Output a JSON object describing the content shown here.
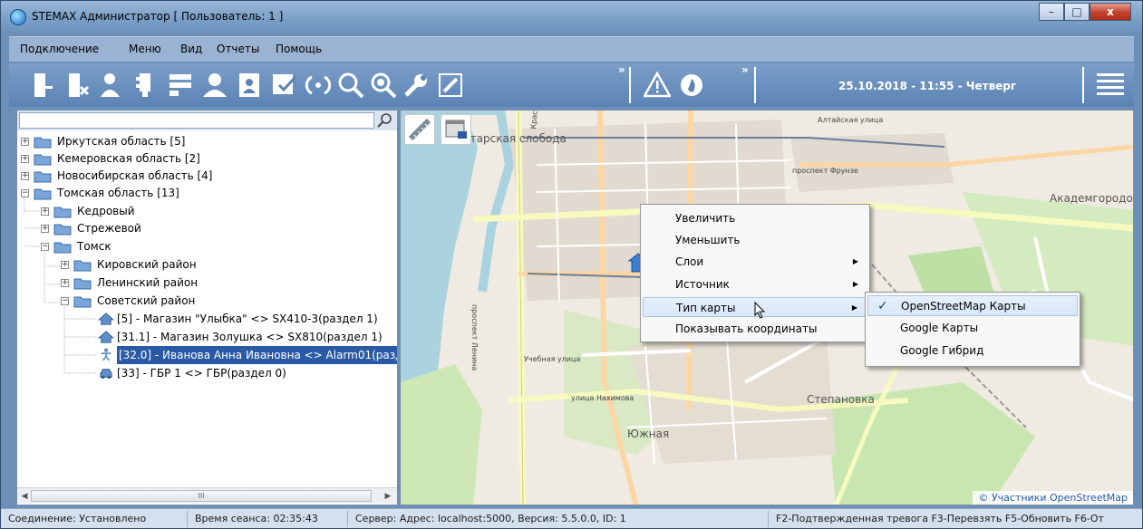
{
  "window": {
    "title": "STEMAX Администратор [ Пользователь: 1 ]",
    "minimize_glyph": "–",
    "maximize_glyph": "□",
    "close_glyph": "x"
  },
  "menu": {
    "items": [
      "Подключение",
      "Меню",
      "Вид",
      "Отчеты",
      "Помощь"
    ]
  },
  "toolbar": {
    "icons": [
      "device-add-icon",
      "device-remove-icon",
      "user-icon",
      "device-icon",
      "list-icon",
      "person-icon",
      "report-icon",
      "check-icon",
      "refresh-icon",
      "search-icon",
      "zoom-search-icon",
      "wrench-icon",
      "edit-icon"
    ],
    "more_glyph": "»",
    "alert_icons": [
      "warning-icon",
      "fire-icon"
    ],
    "datetime": "25.10.2018 - 11:55 - Четверг"
  },
  "search": {
    "value": "",
    "placeholder": ""
  },
  "tree": {
    "nodes": [
      {
        "label": "Иркутская область [5]",
        "expander": "+"
      },
      {
        "label": "Кемеровская область [2]",
        "expander": "+"
      },
      {
        "label": "Новосибирская область [4]",
        "expander": "+"
      },
      {
        "label": "Томская область [13]",
        "expander": "−"
      },
      {
        "label": "Кедровый",
        "expander": "+"
      },
      {
        "label": "Стрежевой",
        "expander": "+"
      },
      {
        "label": "Томск",
        "expander": "−"
      },
      {
        "label": "Кировский район",
        "expander": "+"
      },
      {
        "label": "Ленинский район",
        "expander": "+"
      },
      {
        "label": "Советский район",
        "expander": "−"
      },
      {
        "label": "[5] - Магазин \"Улыбка\" <> SX410-3(раздел 1)"
      },
      {
        "label": "[31.1] - Магазин Золушка <> SX810(раздел 1)"
      },
      {
        "label": "[32.0] - Иванова Анна Ивановна <> Alarm01(разд"
      },
      {
        "label": "[33] - ГБР 1 <> ГБР(раздел 0)"
      }
    ],
    "scroll_thumb_glyph": "III",
    "scroll_left_glyph": "◀",
    "scroll_right_glyph": "▶"
  },
  "map": {
    "labels": {
      "sloboda": "Татарская слобода",
      "akadem": "Академгородок",
      "stepanovka": "Степановка",
      "yuzhnaya": "Южная"
    },
    "streets": {
      "altai": "Алтайская улица",
      "frunze": "проспект Фрунзе",
      "uchebnaya": "Учебная улица",
      "nakhimova": "улица Нахимова",
      "lenina": "проспект Ленина",
      "krasnoarm": "Красноармейская"
    },
    "attribution": "© Участники OpenStreetMap"
  },
  "context_menu": {
    "items": [
      "Увеличить",
      "Уменьшить",
      "Слои",
      "Источник",
      "Тип карты",
      "Показывать координаты"
    ],
    "submenu_arrow": "▶",
    "submenu": {
      "check_glyph": "✓",
      "items": [
        "OpenStreetMap Карты",
        "Google Карты",
        "Google Гибрид"
      ]
    }
  },
  "status": {
    "connection": "Соединение: Установлено",
    "session": "Время сеанса: 02:35:43",
    "server": "Сервер: Адрес: localhost:5000, Версия: 5.5.0.0, ID: 1",
    "hotkeys": "F2-Подтвержденная тревога  F3-Перевзять  F5-Обновить  F6-От"
  }
}
